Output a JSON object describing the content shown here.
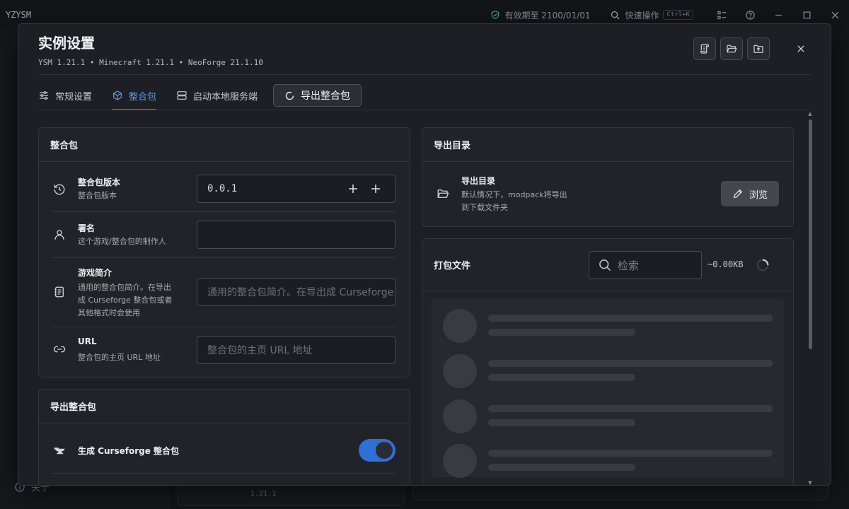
{
  "app": {
    "name": "YZYSM",
    "license_text": "有效期至 2100/01/01",
    "quick_action_label": "快速操作",
    "quick_action_shortcut": "Ctrl+K",
    "sidebar_about": "关于",
    "bg_version": "1.21.1"
  },
  "dialog": {
    "title": "实例设置",
    "subtitle": "YSM 1.21.1 • Minecraft 1.21.1 • NeoForge 21.1.10",
    "header_icons": [
      "scroll-icon",
      "folder-open-icon",
      "folder-upload-icon"
    ]
  },
  "tabs": [
    {
      "label": "常规设置",
      "icon": "sliders-icon",
      "active": false
    },
    {
      "label": "整合包",
      "icon": "package-icon",
      "active": true
    },
    {
      "label": "启动本地服务端",
      "icon": "server-icon",
      "active": false
    }
  ],
  "export_tab_label": "导出整合包",
  "modpack_card": {
    "title": "整合包",
    "version": {
      "title": "整合包版本",
      "desc": "整合包版本",
      "value": "0.0.1"
    },
    "author": {
      "title": "署名",
      "desc": "这个游戏/整合包的制作人",
      "value": ""
    },
    "summary": {
      "title": "游戏简介",
      "desc_lines": [
        "通用的整合包简介。在导出",
        "成 Curseforge 整合包或者",
        "其他格式时会使用"
      ],
      "placeholder": "通用的整合包简介。在导出成 Curseforge 整合包或者其他格式时会使用"
    },
    "url": {
      "title": "URL",
      "desc": "整合包的主页 URL 地址",
      "placeholder": "整合包的主页 URL 地址"
    }
  },
  "export_card": {
    "title": "导出整合包",
    "curseforge": {
      "label": "生成 Curseforge 整合包",
      "enabled": true
    }
  },
  "export_dir_card": {
    "title": "导出目录",
    "row_title": "导出目录",
    "desc_lines": [
      "默认情况下，modpack将导出",
      "到下载文件夹"
    ],
    "browse_label": "浏览"
  },
  "pack_files_card": {
    "title": "打包文件",
    "search_placeholder": "检索",
    "size": "~0.00KB"
  },
  "colors": {
    "accent": "#3d84e6",
    "toggle_on": "#2f6fd6",
    "dialog_bg": "#1e1f24",
    "card_bg": "#222328"
  }
}
